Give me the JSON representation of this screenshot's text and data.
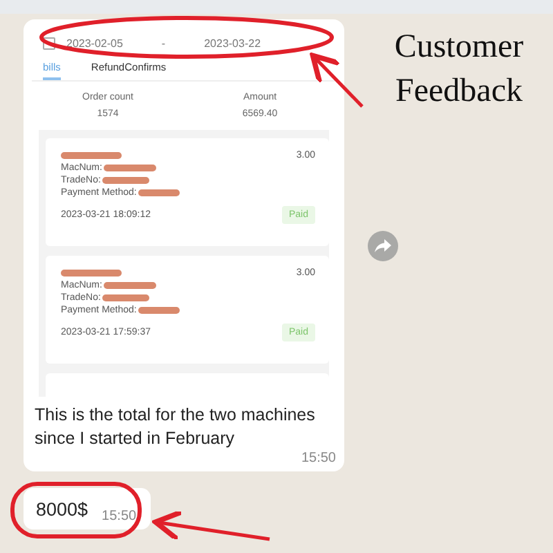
{
  "chat": {
    "messages": [
      {
        "kind": "image",
        "screenshot": {
          "date_from": "2023-02-05",
          "date_separator": "-",
          "date_to": "2023-03-22",
          "tabs": [
            {
              "label": "bills",
              "selected": true
            },
            {
              "label": "RefundConfirms",
              "selected": false
            }
          ],
          "summary": [
            {
              "label": "Order count",
              "value": "1574"
            },
            {
              "label": "Amount",
              "value": "6569.40"
            }
          ],
          "orders": [
            {
              "amount": "3.00",
              "fields": [
                "MacNum:",
                "TradeNo:",
                "Payment Method:"
              ],
              "time": "2023-03-21 18:09:12",
              "status": "Paid"
            },
            {
              "amount": "3.00",
              "fields": [
                "MacNum:",
                "TradeNo:",
                "Payment Method:"
              ],
              "time": "2023-03-21 17:59:37",
              "status": "Paid"
            }
          ]
        },
        "caption": "This is the total for the two machines since I started in February",
        "time": "15:50"
      },
      {
        "kind": "text",
        "text": "8000$",
        "time": "15:50"
      }
    ]
  },
  "annotation": {
    "title": "Customer Feedback"
  }
}
